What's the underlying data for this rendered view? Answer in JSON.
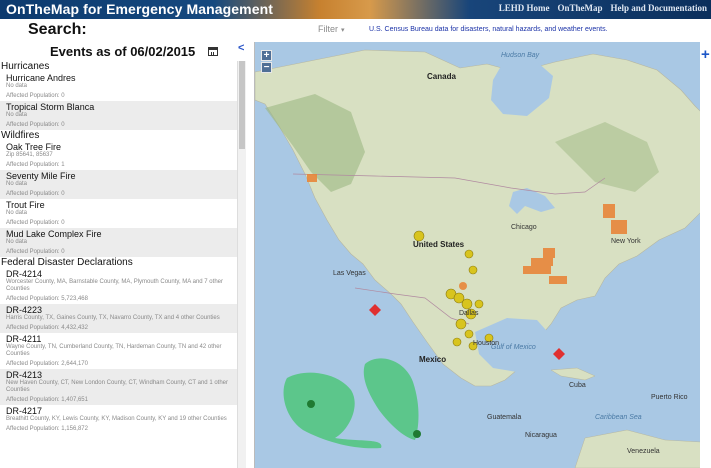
{
  "header": {
    "app_title": "OnTheMap for Emergency Management",
    "nav": [
      "LEHD Home",
      "OnTheMap",
      "Help and Documentation"
    ]
  },
  "search": {
    "label": "Search:",
    "filter_label": "Filter",
    "description": "U.S. Census Bureau data for disasters, natural hazards, and weather events."
  },
  "sidebar": {
    "title": "Events as of 06/02/2015",
    "categories": [
      {
        "name": "Hurricanes",
        "events": [
          {
            "name": "Hurricane Andres",
            "location": "No data",
            "population": "Affected Population: 0"
          },
          {
            "name": "Tropical Storm Blanca",
            "location": "No data",
            "population": "Affected Population: 0"
          }
        ]
      },
      {
        "name": "Wildfires",
        "events": [
          {
            "name": "Oak Tree Fire",
            "location": "Zip 85641, 85637",
            "population": "Affected Population: 1"
          },
          {
            "name": "Seventy Mile Fire",
            "location": "No data",
            "population": "Affected Population: 0"
          },
          {
            "name": "Trout Fire",
            "location": "No data",
            "population": "Affected Population: 0"
          },
          {
            "name": "Mud Lake Complex Fire",
            "location": "No data",
            "population": "Affected Population: 0"
          }
        ]
      },
      {
        "name": "Federal Disaster Declarations",
        "events": [
          {
            "name": "DR-4214",
            "location": "Worcester County, MA, Barnstable County, MA, Plymouth County, MA and 7 other Counties",
            "population": "Affected Population: 5,723,468"
          },
          {
            "name": "DR-4223",
            "location": "Harris County, TX, Gaines County, TX, Navarro County, TX and 4 other Counties",
            "population": "Affected Population: 4,432,432"
          },
          {
            "name": "DR-4211",
            "location": "Wayne County, TN, Cumberland County, TN, Hardeman County, TN and 42 other Counties",
            "population": "Affected Population: 2,644,170"
          },
          {
            "name": "DR-4213",
            "location": "New Haven County, CT, New London County, CT, Windham County, CT and 1 other Counties",
            "population": "Affected Population: 1,407,651"
          },
          {
            "name": "DR-4217",
            "location": "Breathitt County, KY, Lewis County, KY, Madison County, KY and 19 other Counties",
            "population": "Affected Population: 1,156,872"
          }
        ]
      }
    ]
  },
  "map": {
    "labels": [
      "Canada",
      "Hudson Bay",
      "United States",
      "Mexico",
      "Cuba",
      "Gulf of Mexico",
      "Caribbean Sea",
      "Puerto Rico",
      "Las Vegas",
      "Chicago",
      "New York",
      "Dallas",
      "Houston",
      "Guatemala",
      "Nicaragua",
      "Venezuela"
    ],
    "colors": {
      "water": "#a9c8e4",
      "land": "#d8e0c2",
      "forest": "#9db882",
      "storm": "#33c45a",
      "fire": "#e8863a",
      "declaration": "#d8c41e"
    }
  }
}
